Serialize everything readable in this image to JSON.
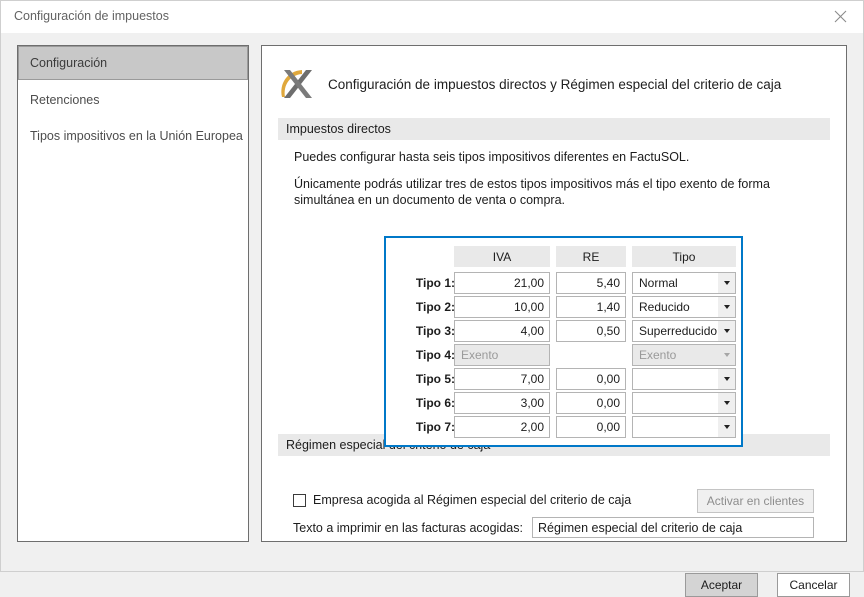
{
  "window": {
    "title": "Configuración de impuestos",
    "close_icon": "close-icon"
  },
  "sidebar": {
    "items": [
      {
        "label": "Configuración",
        "selected": true
      },
      {
        "label": "Retenciones",
        "selected": false
      },
      {
        "label": "Tipos impositivos en la Unión Europea",
        "selected": false
      }
    ]
  },
  "content": {
    "logo_icon": "agencia-tributaria-logo-icon",
    "title": "Configuración de impuestos directos y Régimen especial del criterio de caja",
    "section_direct": {
      "header": "Impuestos directos",
      "paragraph1": "Puedes configurar hasta seis tipos impositivos diferentes en FactuSOL.",
      "paragraph2": "Únicamente podrás utilizar tres de estos tipos impositivos más el tipo exento de forma simultánea en un documento de venta o compra."
    },
    "rates_table": {
      "columns": [
        "IVA",
        "RE",
        "Tipo"
      ],
      "highlight_color": "#0078c8",
      "rows": [
        {
          "label": "Tipo 1:",
          "iva": "21,00",
          "re": "5,40",
          "tipo": "Normal",
          "disabled": false,
          "has_re": true
        },
        {
          "label": "Tipo 2:",
          "iva": "10,00",
          "re": "1,40",
          "tipo": "Reducido",
          "disabled": false,
          "has_re": true
        },
        {
          "label": "Tipo 3:",
          "iva": "4,00",
          "re": "0,50",
          "tipo": "Superreducido",
          "disabled": false,
          "has_re": true
        },
        {
          "label": "Tipo 4:",
          "iva": "Exento",
          "re": "",
          "tipo": "Exento",
          "disabled": true,
          "has_re": false
        },
        {
          "label": "Tipo 5:",
          "iva": "7,00",
          "re": "0,00",
          "tipo": "",
          "disabled": false,
          "has_re": true
        },
        {
          "label": "Tipo 6:",
          "iva": "3,00",
          "re": "0,00",
          "tipo": "",
          "disabled": false,
          "has_re": true
        },
        {
          "label": "Tipo 7:",
          "iva": "2,00",
          "re": "0,00",
          "tipo": "",
          "disabled": false,
          "has_re": true
        }
      ]
    },
    "section_caja": {
      "header": "Régimen especial del criterio de caja",
      "checkbox_label": "Empresa acogida al Régimen especial del criterio de caja",
      "checkbox_checked": false,
      "activar_button": "Activar en clientes",
      "texto_label": "Texto a imprimir en las facturas acogidas:",
      "texto_value": "Régimen especial del criterio de caja"
    }
  },
  "footer": {
    "accept_label": "Aceptar",
    "cancel_label": "Cancelar"
  }
}
